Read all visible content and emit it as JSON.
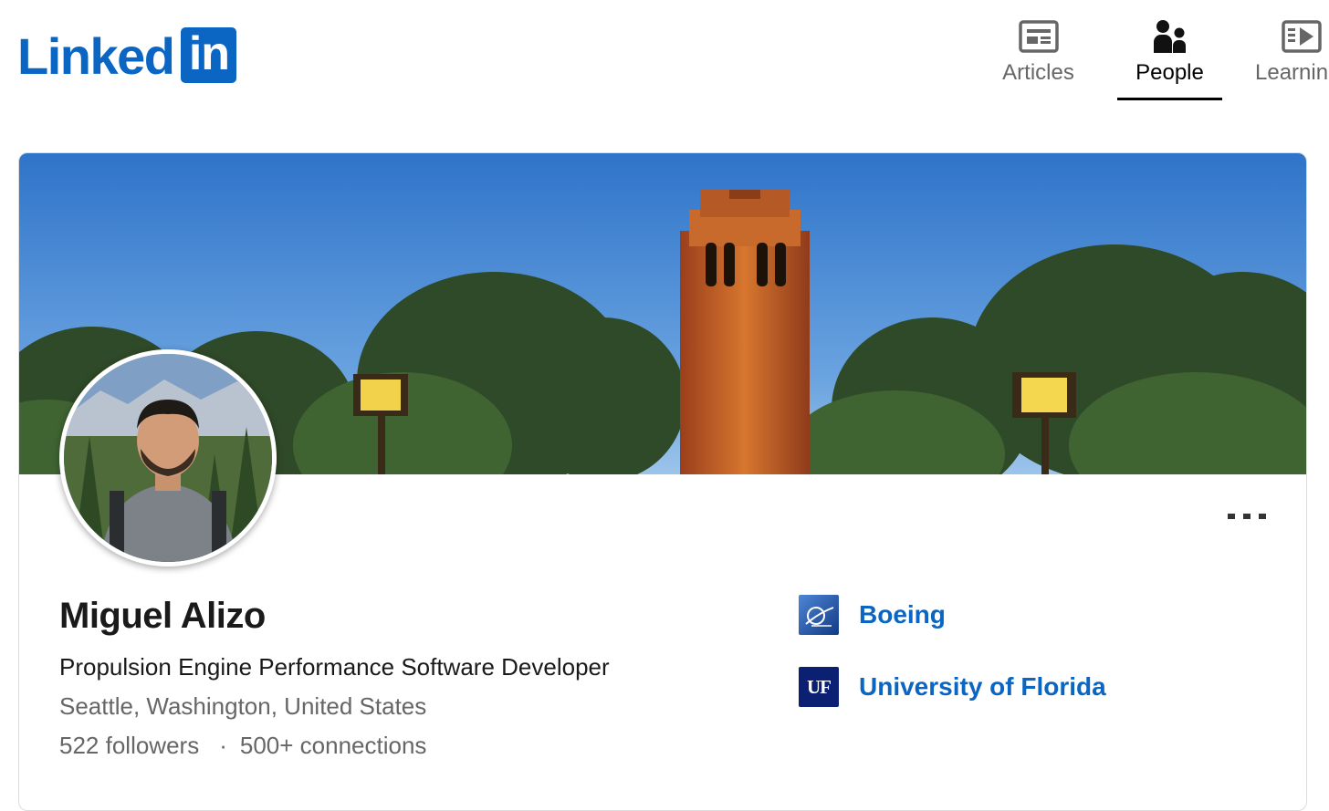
{
  "brand": {
    "logo_text": "Linked",
    "logo_box": "in",
    "color": "#0a66c2"
  },
  "nav": {
    "items": [
      {
        "label": "Articles",
        "icon": "articles-icon",
        "active": false
      },
      {
        "label": "People",
        "icon": "people-icon",
        "active": true
      },
      {
        "label": "Learnin",
        "icon": "learning-icon",
        "active": false
      }
    ]
  },
  "profile": {
    "name": "Miguel Alizo",
    "headline": "Propulsion Engine Performance Software Developer",
    "location": "Seattle, Washington, United States",
    "followers": "522 followers",
    "separator": "·",
    "connections": "500+ connections",
    "more_icon": "more-options-icon"
  },
  "organizations": [
    {
      "name": "Boeing",
      "logo": "boeing-logo",
      "logo_bg": "#1d4fa3"
    },
    {
      "name": "University of Florida",
      "logo": "uf-logo",
      "logo_text": "UF",
      "logo_bg": "#0b1f73"
    }
  ],
  "colors": {
    "link_blue": "#0a66c2",
    "muted_text": "#666666",
    "sky": "#3f86d6"
  }
}
